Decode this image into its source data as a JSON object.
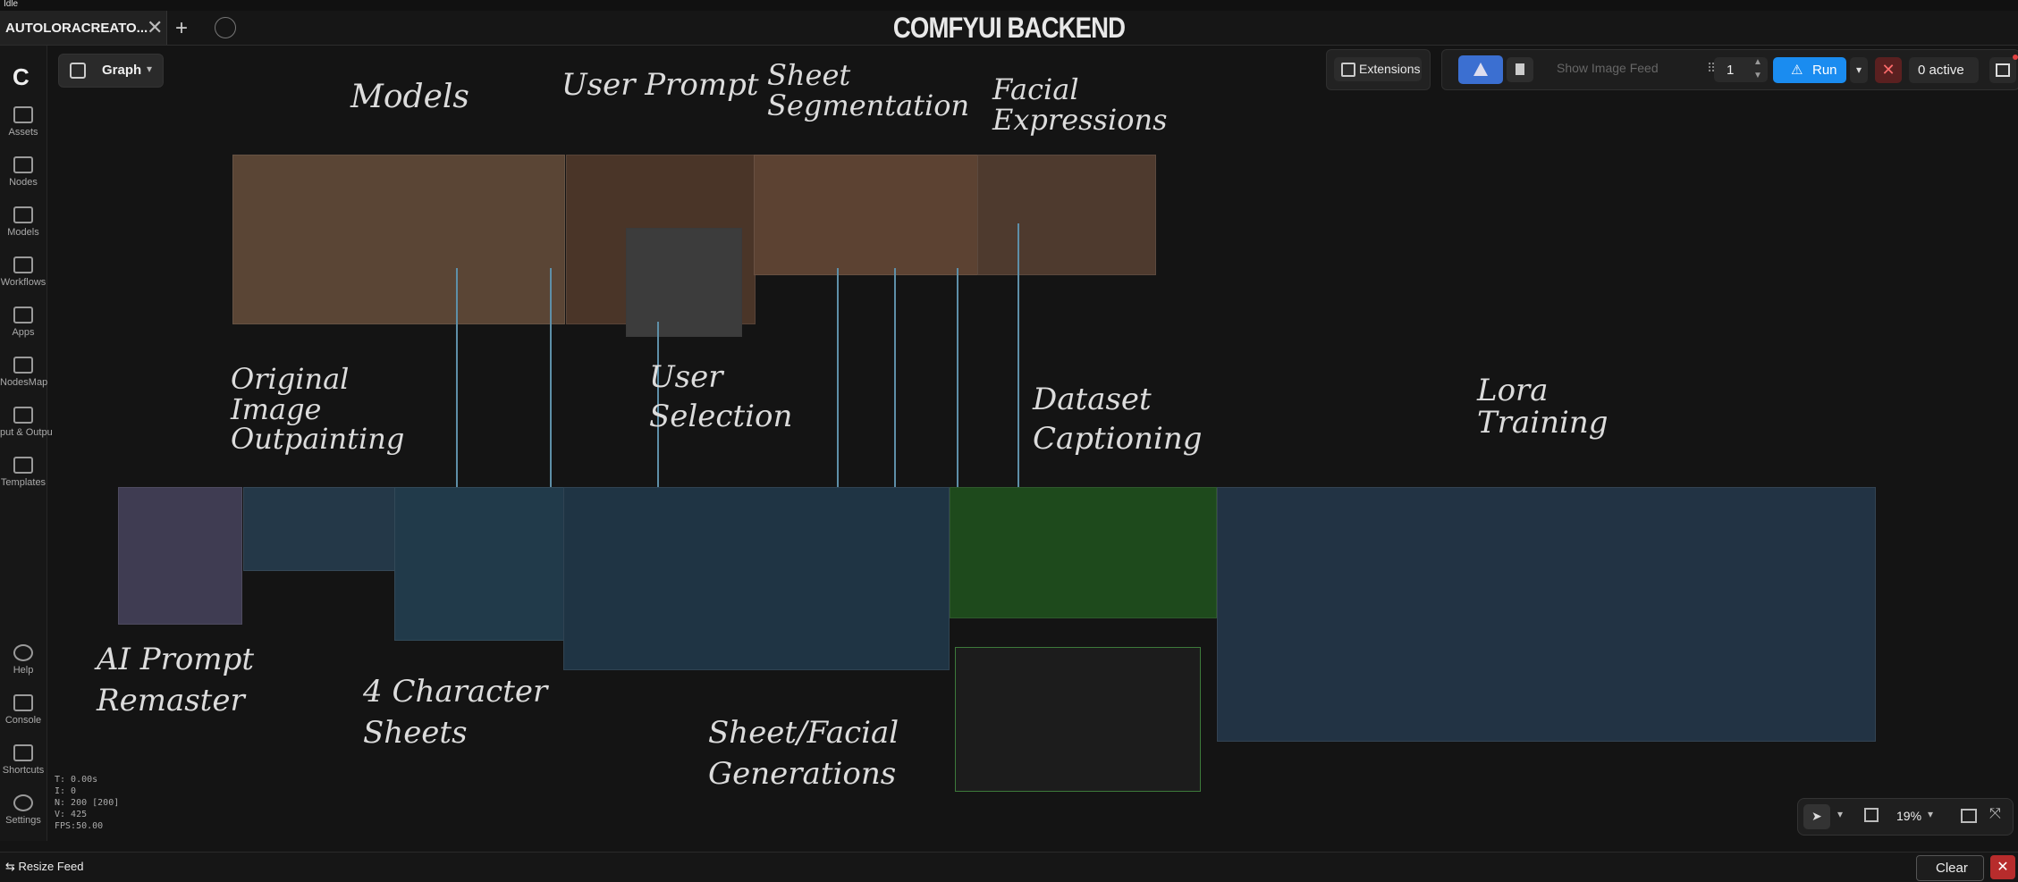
{
  "status": {
    "text": "Idle"
  },
  "tabs": [
    {
      "label": "AUTOLORACREATO...",
      "close": "✕"
    }
  ],
  "new_tab_label": "+",
  "app_title": "COMFYUI BACKEND",
  "sidebar": {
    "items": [
      {
        "label": "Assets",
        "icon": "image-icon"
      },
      {
        "label": "Nodes",
        "icon": "node-icon"
      },
      {
        "label": "Models",
        "icon": "cube-icon"
      },
      {
        "label": "Workflows",
        "icon": "workflow-icon"
      },
      {
        "label": "Apps",
        "icon": "apps-icon"
      },
      {
        "label": "NodesMap",
        "icon": "map-icon"
      },
      {
        "label": "put & Outpu",
        "icon": "image-io-icon"
      },
      {
        "label": "Templates",
        "icon": "templates-icon"
      }
    ],
    "bottom_items": [
      {
        "label": "Help",
        "icon": "help-icon"
      },
      {
        "label": "Console",
        "icon": "console-icon"
      },
      {
        "label": "Shortcuts",
        "icon": "keyboard-icon"
      },
      {
        "label": "Settings",
        "icon": "gear-icon"
      }
    ]
  },
  "graph_button": {
    "label": "Graph"
  },
  "toolbar": {
    "extensions_label": "Extensions",
    "show_image_feed_label": "Show Image Feed",
    "batch_count": "1",
    "run_label": "Run",
    "active_label": "0 active"
  },
  "annotations": {
    "models": "Models",
    "user_prompt": "User Prompt",
    "sheet_segmentation": "Sheet\nSegmentation",
    "facial_expressions": "Facial\nExpressions",
    "original_outpainting": "Original\nImage\nOutpainting",
    "user_selection": "User\nSelection",
    "dataset_captioning": "Dataset\nCaptioning",
    "lora_training": "Lora\nTraining",
    "ai_prompt_remaster": "AI Prompt\nRemaster",
    "character_sheets": "4 Character\nSheets",
    "sheet_facial_generations": "Sheet/Facial\nGenerations"
  },
  "stats": {
    "t": "T: 0.00s",
    "i": "I: 0",
    "n": "N: 200 [200]",
    "v": "V: 425",
    "fps": "FPS:50.00"
  },
  "canvas_controls": {
    "zoom": "19%"
  },
  "bottombar": {
    "resize_feed_label": "Resize Feed",
    "clear_label": "Clear",
    "close": "✕"
  },
  "colors": {
    "accent": "#1a8cf0",
    "group_brown": "#5a3f2c",
    "group_blue": "#223a4a",
    "group_green": "#1d4a1a",
    "group_purple": "#3a3650"
  }
}
